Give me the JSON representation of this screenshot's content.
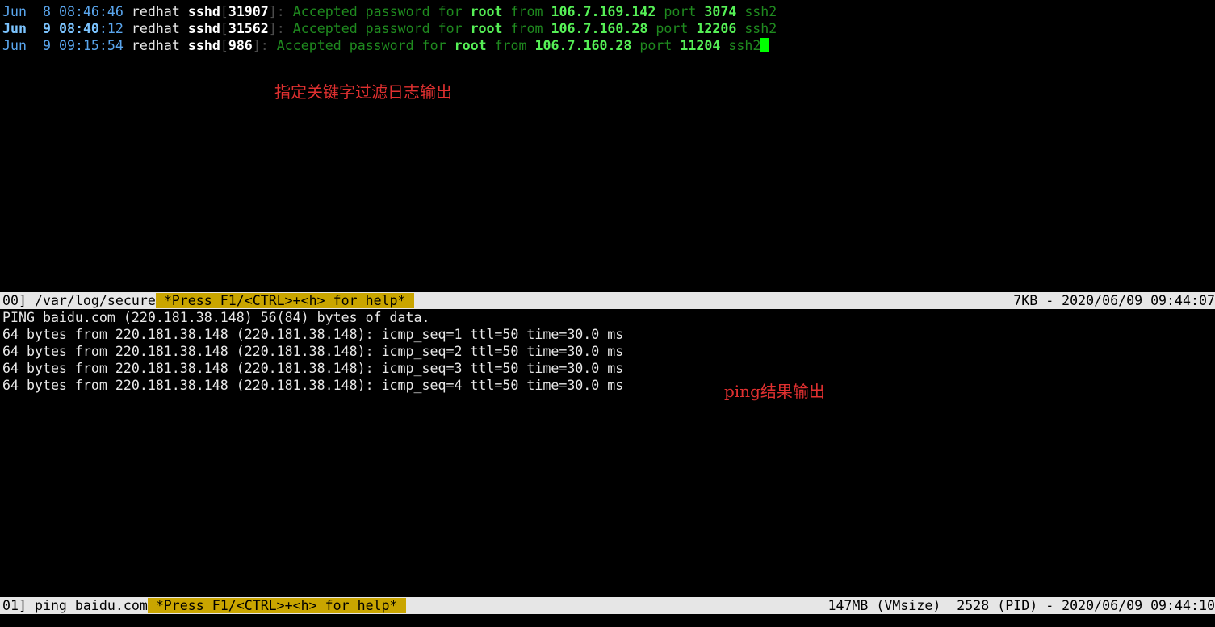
{
  "log_window": {
    "lines": [
      {
        "month": "Jun",
        "day": " 8",
        "time_hm": "08:46",
        "time_s": ":46",
        "host": "redhat",
        "proc": "sshd",
        "pid": "31907",
        "msg": "Accepted password for",
        "user": "root",
        "from_word": "from",
        "ip": "106.7.169.142",
        "port_word": "port",
        "port": "3074",
        "proto": "ssh2"
      },
      {
        "month": "Jun",
        "day": " 9",
        "time_hm": "08:40",
        "time_s": ":12",
        "host": "redhat",
        "proc": "sshd",
        "pid": "31562",
        "msg": "Accepted password for",
        "user": "root",
        "from_word": "from",
        "ip": "106.7.160.28",
        "port_word": "port",
        "port": "12206",
        "proto": "ssh2"
      },
      {
        "month": "Jun",
        "day": " 9",
        "time_hm": "09:15",
        "time_s": ":54",
        "host": "redhat",
        "proc": "sshd",
        "pid": "986",
        "msg": "Accepted password for",
        "user": "root",
        "from_word": "from",
        "ip": "106.7.160.28",
        "port_word": "port",
        "port": "11204",
        "proto": "ssh2"
      }
    ],
    "annotation": "指定关键字过滤日志输出"
  },
  "status_bar_1": {
    "left": "00] /var/log/secure",
    "help": " *Press F1/<CTRL>+<h> for help*",
    "right": "7KB - 2020/06/09 09:44:07"
  },
  "ping_window": {
    "lines": [
      "PING baidu.com (220.181.38.148) 56(84) bytes of data.",
      "64 bytes from 220.181.38.148 (220.181.38.148): icmp_seq=1 ttl=50 time=30.0 ms",
      "64 bytes from 220.181.38.148 (220.181.38.148): icmp_seq=2 ttl=50 time=30.0 ms",
      "64 bytes from 220.181.38.148 (220.181.38.148): icmp_seq=3 ttl=50 time=30.0 ms",
      "64 bytes from 220.181.38.148 (220.181.38.148): icmp_seq=4 ttl=50 time=30.0 ms"
    ],
    "annotation": "ping结果输出"
  },
  "status_bar_2": {
    "left": "01] ping baidu.com",
    "help": " *Press F1/<CTRL>+<h> for help*",
    "right": "147MB (VMsize)  2528 (PID) - 2020/06/09 09:44:10"
  },
  "colors": {
    "background": "#000000",
    "accepted_text": "#1f8a1f",
    "highlight": "#56f056",
    "help_badge": "#c9a500",
    "status_bar": "#e6e6e6",
    "annotation": "#e03030",
    "cursor": "#00ff00"
  }
}
